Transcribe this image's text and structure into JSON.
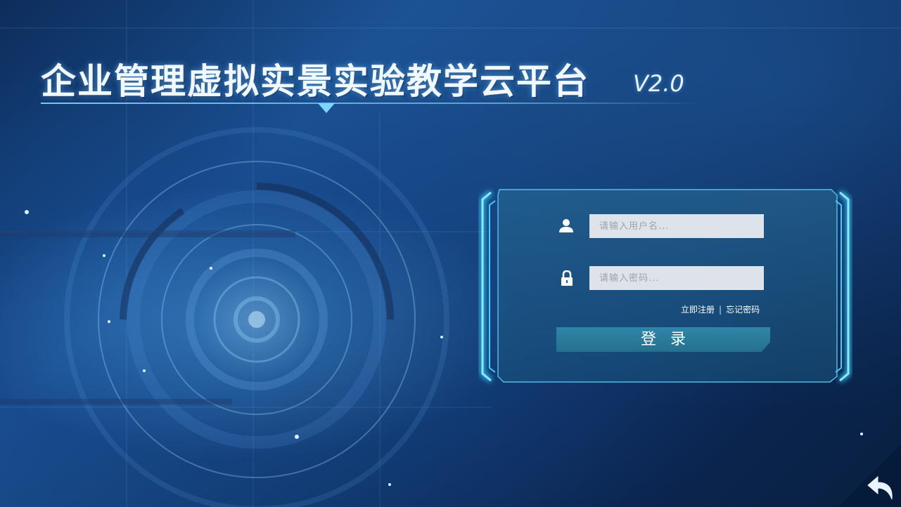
{
  "app": {
    "title": "企业管理虚拟实景实验教学云平台",
    "version": "V2.0"
  },
  "login": {
    "username_placeholder": "请输入用户名...",
    "password_placeholder": "请输入密码...",
    "username_value": "",
    "password_value": "",
    "register_link": "立即注册",
    "separator": "|",
    "forgot_link": "忘记密码",
    "submit_label": "登录"
  },
  "icons": {
    "user": "user-icon",
    "lock": "lock-icon",
    "back": "back-arrow-icon"
  },
  "colors": {
    "accent": "#3fd0ff",
    "button": "#2f86a8",
    "input_bg": "#dde3e8"
  }
}
